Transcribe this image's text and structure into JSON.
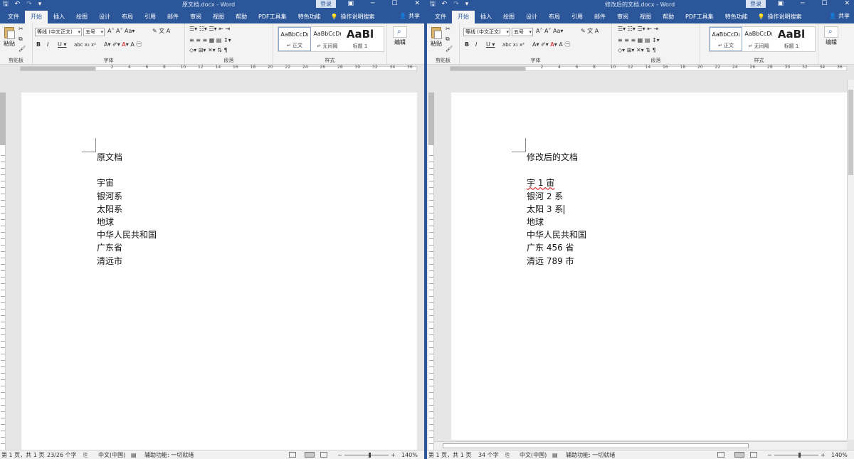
{
  "left": {
    "title": "原文档.docx  -  Word",
    "login": "登录",
    "lines": [
      "原文档",
      "",
      "宇宙",
      "银河系",
      "太阳系",
      "地球",
      "中华人民共和国",
      "广东省",
      "清远市"
    ],
    "status": {
      "page": "第 1 页，共 1 页",
      "words": "23/26 个字",
      "lang": "中文(中国)",
      "a11y": "辅助功能: 一切就绪",
      "zoom": "140%"
    }
  },
  "right": {
    "title": "修改后的文档.docx  -  Word",
    "login": "登录",
    "lines": [
      "修改后的文档",
      "",
      "宇 1 宙",
      "银河 2 系",
      "太阳 3 系",
      "地球",
      "中华人民共和国",
      "广东 456 省",
      "清远 789 市"
    ],
    "status": {
      "page": "第 1 页，共 1 页",
      "words": "34 个字",
      "lang": "中文(中国)",
      "a11y": "辅助功能: 一切就绪",
      "zoom": "140%"
    }
  },
  "ribbon": {
    "tabs": [
      "文件",
      "开始",
      "插入",
      "绘图",
      "设计",
      "布局",
      "引用",
      "邮件",
      "审阅",
      "视图",
      "帮助",
      "PDF工具集",
      "特色功能"
    ],
    "search": "操作说明搜索",
    "share": "共享",
    "paste": "粘贴",
    "font": "等线 (中文正文)",
    "size": "五号",
    "groups": {
      "clipboard": "剪贴板",
      "font": "字体",
      "paragraph": "段落",
      "styles": "样式",
      "editing": "编辑"
    },
    "styles": [
      {
        "sample": "AaBbCcDı",
        "name": "↵ 正文"
      },
      {
        "sample": "AaBbCcDı",
        "name": "↵ 无间隔"
      },
      {
        "sample": "AaBl",
        "name": "标题 1"
      }
    ],
    "edit_label": "编辑"
  },
  "icons": {
    "save": "save-icon",
    "undo": "undo-icon",
    "redo": "redo-icon",
    "search": "lightbulb-icon",
    "share": "person-icon",
    "find": "magnifier-icon"
  }
}
